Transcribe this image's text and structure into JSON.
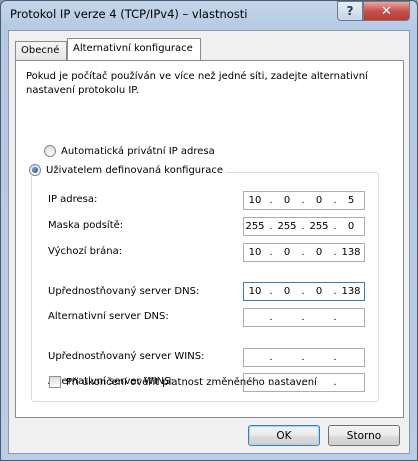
{
  "window": {
    "title": "Protokol IP verze 4 (TCP/IPv4) – vlastnosti",
    "help_label": "?",
    "close_label": "✕"
  },
  "tabs": [
    {
      "label": "Obecné"
    },
    {
      "label": "Alternativní konfigurace"
    }
  ],
  "description": "Pokud je počítač používán ve více než jedné síti, zadejte alternativní nastavení protokolu IP.",
  "radios": {
    "auto": {
      "label": "Automatická privátní IP adresa",
      "checked": false
    },
    "user": {
      "label": "Uživatelem definovaná konfigurace",
      "checked": true
    }
  },
  "fields": {
    "ip": {
      "label": "IP adresa:",
      "octets": [
        "10",
        "0",
        "0",
        "5"
      ]
    },
    "mask": {
      "label": "Maska podsítě:",
      "octets": [
        "255",
        "255",
        "255",
        "0"
      ]
    },
    "gateway": {
      "label": "Výchozí brána:",
      "octets": [
        "10",
        "0",
        "0",
        "138"
      ]
    },
    "dns_pref": {
      "label": "Upřednostňovaný server DNS:",
      "octets": [
        "10",
        "0",
        "0",
        "138"
      ]
    },
    "dns_alt": {
      "label": "Alternativní server DNS:",
      "octets": [
        "",
        "",
        "",
        ""
      ]
    },
    "wins_pref": {
      "label": "Upřednostňovaný server WINS:",
      "octets": [
        "",
        "",
        "",
        ""
      ]
    },
    "wins_alt": {
      "label": "Alternativní server WINS:",
      "octets": [
        "",
        "",
        "",
        ""
      ]
    }
  },
  "ip_separator": ".",
  "checkbox": {
    "label": "Při ukončení ověřit platnost změněného nastavení",
    "checked": false
  },
  "buttons": {
    "ok": "OK",
    "cancel": "Storno"
  }
}
